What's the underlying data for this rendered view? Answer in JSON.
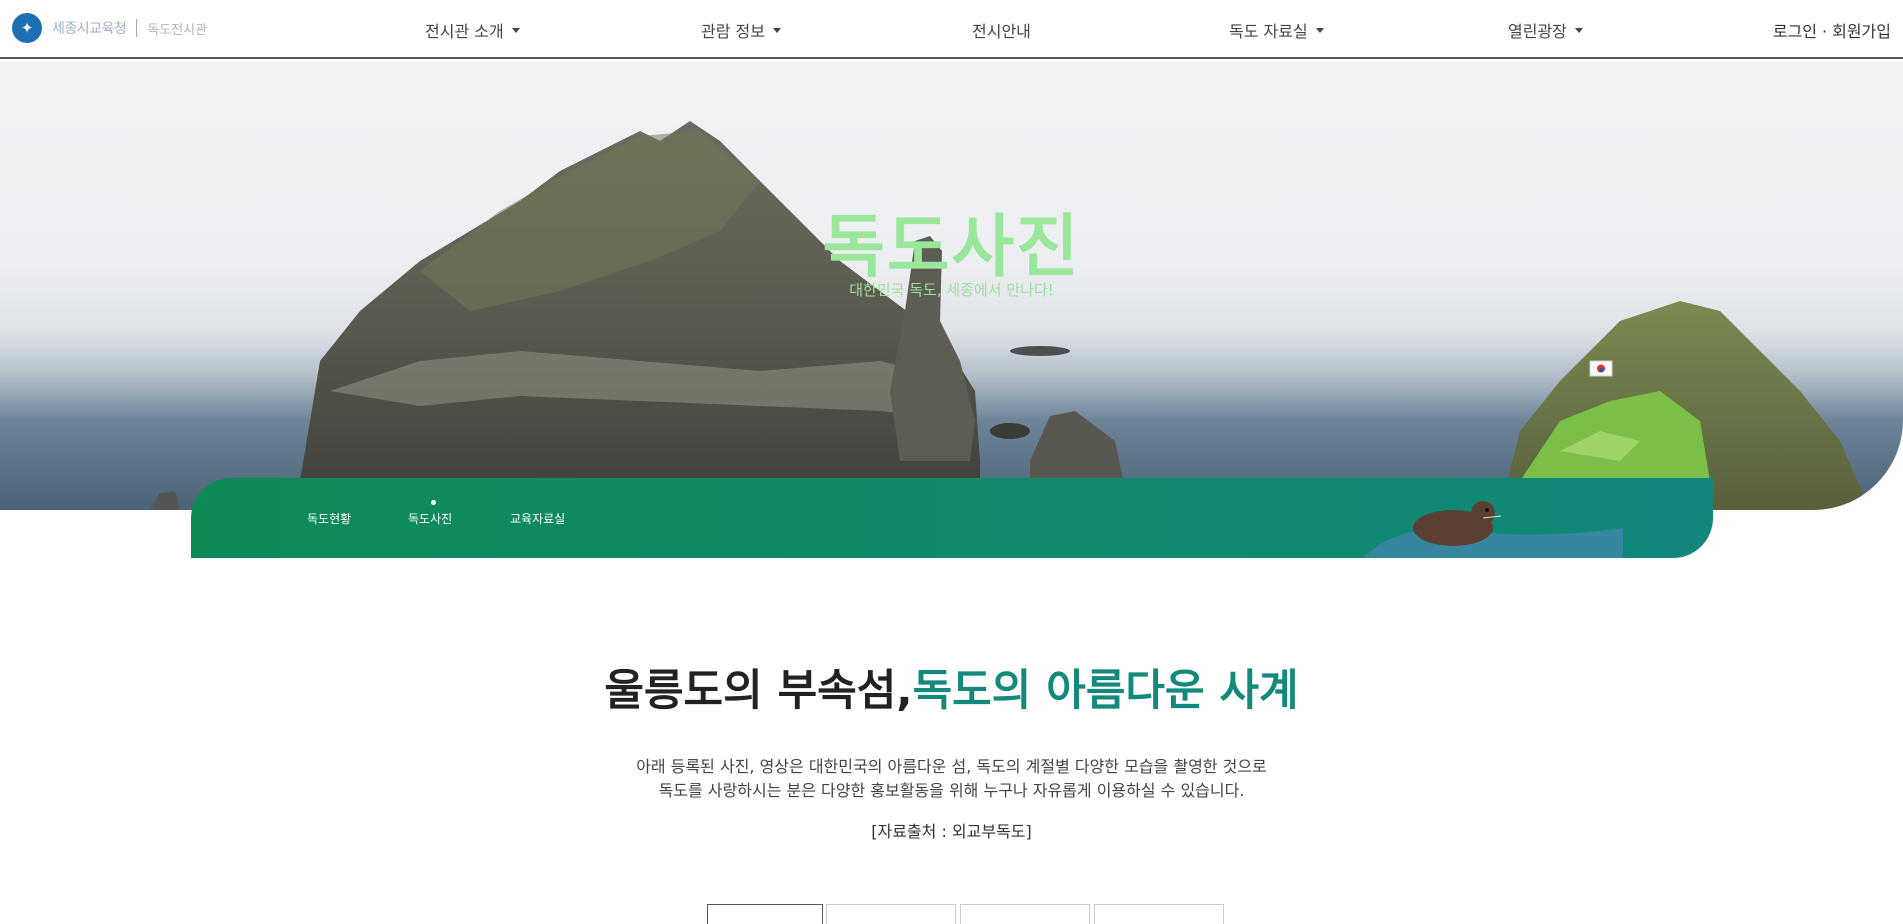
{
  "header": {
    "logo_icon": "dokdo-emblem-icon",
    "logo_text": "세종시교육청",
    "logo_sub": "독도전시관",
    "nav": [
      {
        "label": "전시관 소개",
        "has_dropdown": true
      },
      {
        "label": "관람 정보",
        "has_dropdown": true
      },
      {
        "label": "전시안내",
        "has_dropdown": false
      },
      {
        "label": "독도 자료실",
        "has_dropdown": true
      },
      {
        "label": "열린광장",
        "has_dropdown": true
      }
    ],
    "login": "로그인",
    "separator": "·",
    "signup": "회원가입"
  },
  "hero": {
    "title": "독도사진",
    "subtitle": "대한민국 독도, 세종에서 만나다!"
  },
  "subnav": {
    "items": [
      "독도현황",
      "독도사진",
      "교육자료실"
    ],
    "active": "독도사진"
  },
  "content": {
    "headline_main": "울릉도의 부속섬,",
    "headline_accent": "독도의 아름다운 사계",
    "desc_line1": "아래 등록된 사진, 영상은 대한민국의 아름다운 섬, 독도의 계절별 다양한 모습을 촬영한 것으로",
    "desc_line2": "독도를 사랑하시는 분은 다양한 홍보활동을 위해 누구나 자유롭게 이용하실 수 있습니다.",
    "source": "[자료출처 : 외교부독도]"
  },
  "colors": {
    "accent": "#12897a",
    "subnav_green": "#0d8b55",
    "hero_title": "#9ae69a"
  }
}
